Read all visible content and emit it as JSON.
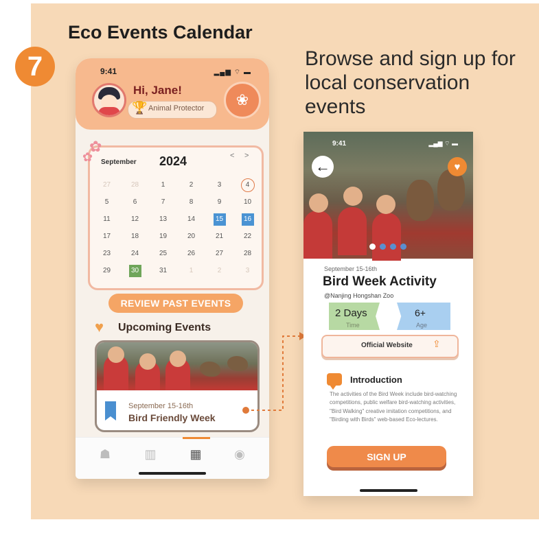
{
  "step": {
    "number": "7",
    "title": "Eco Events Calendar",
    "description": "Browse and sign up for local conservation events"
  },
  "phone1": {
    "status_time": "9:41",
    "status_icons": "▂▄▆ ⌔ ▬",
    "greeting": "Hi, Jane!",
    "badge": "Animal Protector",
    "calendar": {
      "month": "September",
      "year": "2024",
      "prev": "<",
      "next": ">",
      "days": [
        {
          "label": "27",
          "state": "muted"
        },
        {
          "label": "28",
          "state": "muted"
        },
        {
          "label": "1",
          "state": ""
        },
        {
          "label": "2",
          "state": ""
        },
        {
          "label": "3",
          "state": ""
        },
        {
          "label": "4",
          "state": "today"
        },
        {
          "label": "",
          "state": "muted"
        },
        {
          "label": "5",
          "state": ""
        },
        {
          "label": "6",
          "state": ""
        },
        {
          "label": "7",
          "state": ""
        },
        {
          "label": "8",
          "state": ""
        },
        {
          "label": "9",
          "state": ""
        },
        {
          "label": "10",
          "state": ""
        },
        {
          "label": "",
          "state": "muted"
        },
        {
          "label": "11",
          "state": ""
        },
        {
          "label": "12",
          "state": ""
        },
        {
          "label": "13",
          "state": ""
        },
        {
          "label": "14",
          "state": ""
        },
        {
          "label": "15",
          "state": "sel-blue"
        },
        {
          "label": "16",
          "state": "sel-blue"
        },
        {
          "label": "",
          "state": "muted"
        },
        {
          "label": "17",
          "state": ""
        },
        {
          "label": "18",
          "state": ""
        },
        {
          "label": "19",
          "state": ""
        },
        {
          "label": "20",
          "state": ""
        },
        {
          "label": "21",
          "state": ""
        },
        {
          "label": "22",
          "state": ""
        },
        {
          "label": "",
          "state": "muted"
        },
        {
          "label": "23",
          "state": ""
        },
        {
          "label": "24",
          "state": ""
        },
        {
          "label": "25",
          "state": ""
        },
        {
          "label": "26",
          "state": ""
        },
        {
          "label": "27",
          "state": ""
        },
        {
          "label": "28",
          "state": ""
        },
        {
          "label": "",
          "state": "muted"
        },
        {
          "label": "29",
          "state": ""
        },
        {
          "label": "30",
          "state": "sel-green"
        },
        {
          "label": "31",
          "state": ""
        },
        {
          "label": "1",
          "state": "muted"
        },
        {
          "label": "2",
          "state": "muted"
        },
        {
          "label": "3",
          "state": "muted"
        },
        {
          "label": "",
          "state": "muted"
        }
      ]
    },
    "review_button": "REVIEW PAST EVENTS",
    "upcoming_title": "Upcoming Events",
    "event": {
      "date": "September 15-16th",
      "name": "Bird Friendly Week"
    },
    "tabs": [
      {
        "name": "tab-home",
        "icon": "home-icon",
        "glyph": "☗"
      },
      {
        "name": "tab-books",
        "icon": "book-icon",
        "glyph": "▥"
      },
      {
        "name": "tab-calendar",
        "icon": "calendar-icon",
        "glyph": "▦"
      },
      {
        "name": "tab-profile",
        "icon": "profile-icon",
        "glyph": "◉"
      }
    ]
  },
  "phone2": {
    "status_time": "9:41",
    "status_icons": "▂▄▆ ⌔ ▬",
    "back_glyph": "←",
    "fav_glyph": "♥",
    "date": "September 15-16th",
    "title": "Bird Week Activity",
    "location": "@Nanjing Hongshan Zoo",
    "duration_value": "2 Days",
    "duration_label": "Time",
    "age_value": "6+",
    "age_label": "Age",
    "website_label": "Official Website",
    "share_glyph": "⇪",
    "intro_title": "Introduction",
    "intro_text": "The activities of the Bird Week include bird-watching competitions, public welfare bird-watching activities, \"Bird Walking\" creative imitation competitions, and \"Birding with Birds\" web-based Eco-lectures.",
    "signup_button": "SIGN UP"
  },
  "colors": {
    "accent": "#ef8a33",
    "panel": "#f7d9b7",
    "selected_blue": "#4a93d3",
    "selected_green": "#6fa55a"
  }
}
